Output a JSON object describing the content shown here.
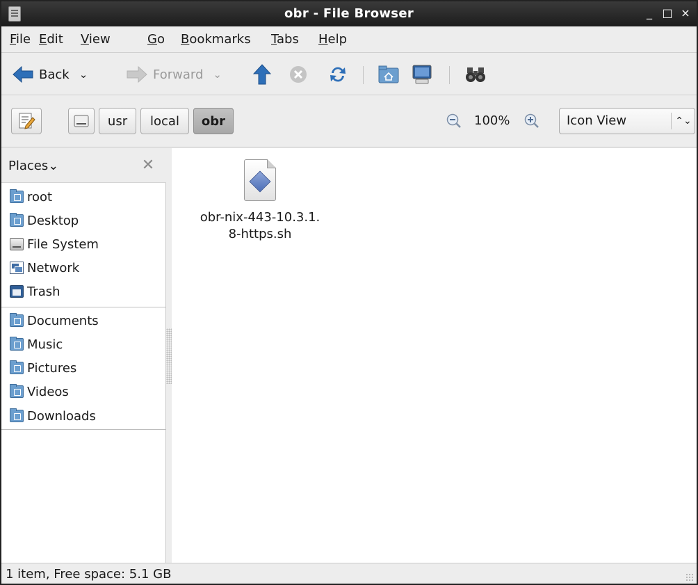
{
  "window": {
    "title": "obr - File Browser",
    "minimize_symbol": "_",
    "maximize_symbol": "□",
    "close_symbol": "×"
  },
  "menubar": {
    "items": [
      {
        "mnemonic": "F",
        "rest": "ile"
      },
      {
        "mnemonic": "E",
        "rest": "dit"
      },
      {
        "mnemonic": "V",
        "rest": "iew"
      },
      {
        "mnemonic": "G",
        "rest": "o"
      },
      {
        "mnemonic": "B",
        "rest": "ookmarks"
      },
      {
        "mnemonic": "T",
        "rest": "abs"
      },
      {
        "mnemonic": "H",
        "rest": "elp"
      }
    ]
  },
  "toolbar": {
    "back_label": "Back",
    "forward_label": "Forward",
    "dropdown_symbol": "⌄",
    "icons": [
      "back-arrow-icon",
      "forward-arrow-icon",
      "up-arrow-icon",
      "stop-icon",
      "reload-icon",
      "home-folder-icon",
      "computer-icon",
      "search-binoculars-icon"
    ],
    "colors": {
      "back_arrow": "#2e6fb8",
      "up_arrow": "#2e6fb8",
      "reload": "#2e6fb8",
      "stop": "#b9b9b9"
    }
  },
  "location": {
    "crumbs": [
      {
        "label": "usr"
      },
      {
        "label": "local"
      },
      {
        "label": "obr",
        "active": true
      }
    ],
    "zoom_level": "100%",
    "view_mode": "Icon View",
    "select_arrows": "⌃⌄"
  },
  "sidebar": {
    "header": "Places",
    "header_chevron": "⌄",
    "close_symbol": "✕",
    "places": [
      {
        "label": "root",
        "icon": "home-folder-icon"
      },
      {
        "label": "Desktop",
        "icon": "desktop-folder-icon"
      },
      {
        "label": "File System",
        "icon": "drive-icon"
      },
      {
        "label": "Network",
        "icon": "network-icon"
      },
      {
        "label": "Trash",
        "icon": "trash-icon"
      }
    ],
    "bookmarks": [
      {
        "label": "Documents",
        "icon": "documents-folder-icon"
      },
      {
        "label": "Music",
        "icon": "music-folder-icon"
      },
      {
        "label": "Pictures",
        "icon": "pictures-folder-icon"
      },
      {
        "label": "Videos",
        "icon": "videos-folder-icon"
      },
      {
        "label": "Downloads",
        "icon": "downloads-folder-icon"
      }
    ]
  },
  "files": [
    {
      "name_line1": "obr-nix-443-10.3.1.",
      "name_line2": "8-https.sh",
      "icon": "shell-script-file-icon"
    }
  ],
  "status": {
    "text": "1 item, Free space: 5.1 GB"
  }
}
